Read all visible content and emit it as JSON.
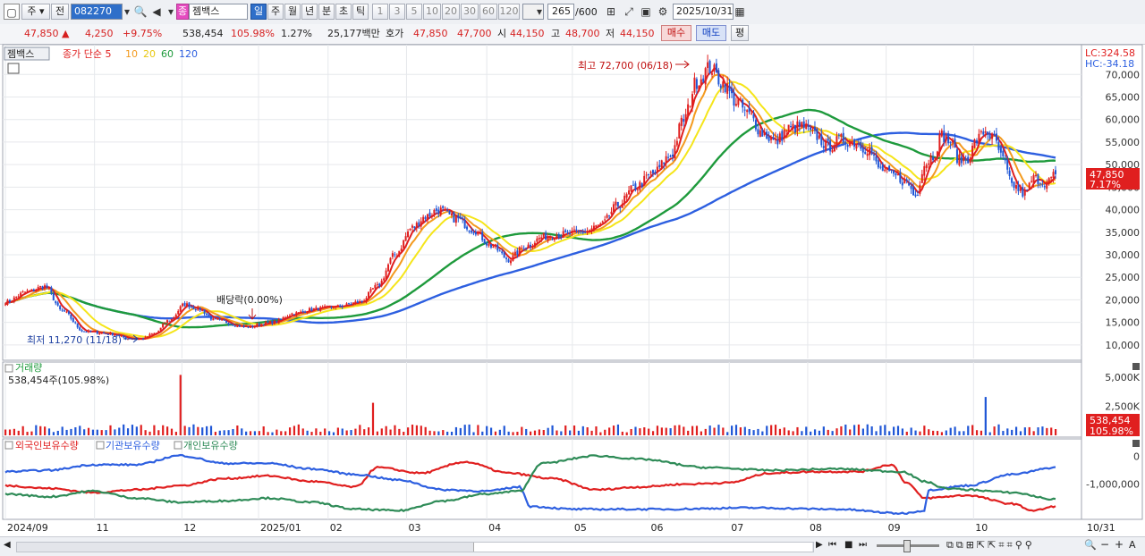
{
  "toolbar": {
    "market": "주",
    "prev_label": "전",
    "stock_code": "082270",
    "stock_name": "젬백스",
    "period_labels": [
      "일",
      "주",
      "월",
      "년",
      "분",
      "초",
      "틱"
    ],
    "interval_labels": [
      "1",
      "3",
      "5",
      "10",
      "20",
      "30",
      "60",
      "120"
    ],
    "count": "265",
    "count_total": "/600",
    "date": "2025/10/31"
  },
  "info": {
    "price": "47,850",
    "change": "4,250",
    "change_pct": "+9.75%",
    "volume": "538,454",
    "volume_ratio": "105.98%",
    "turnover": "1.27%",
    "amount": "25,177백만",
    "quote_label": "호가",
    "ask": "47,850",
    "bid": "47,700",
    "open_label": "시",
    "open": "44,150",
    "high_label": "고",
    "high": "48,700",
    "low_label": "저",
    "low": "44,150",
    "buy_label": "매수",
    "sell_label": "매도",
    "eval_label": "평"
  },
  "colors": {
    "up": "#e01f1f",
    "down": "#1f56d6",
    "ma5": "#e01f1f",
    "ma10": "#f39a1e",
    "ma20": "#f5e51a",
    "ma60": "#1e9a3c",
    "ma120": "#2d5fe0",
    "foreign": "#e01f1f",
    "institution": "#2d5fe0",
    "individual": "#2e8b57"
  },
  "chart_data": [
    {
      "type": "candlestick",
      "title": "젬백스",
      "legend": [
        "종가 단순 5",
        "10",
        "20",
        "60",
        "120"
      ],
      "scale_top": "LC:324.58",
      "scale_bottom": "HC:-34.18",
      "y_ticks": [
        "70,000",
        "65,000",
        "60,000",
        "55,000",
        "50,000",
        "45,000",
        "40,000",
        "35,000",
        "30,000",
        "25,000",
        "20,000",
        "15,000",
        "10,000"
      ],
      "ylim": [
        7000,
        76000
      ],
      "x_ticks": [
        "2024/09",
        "11",
        "12",
        "2025/01",
        "02",
        "03",
        "04",
        "05",
        "06",
        "07",
        "08",
        "09",
        "10",
        "10/31"
      ],
      "annotations": {
        "high": "최고 72,700 (06/18)",
        "low": "최저 11,270 (11/18)",
        "dividend": "배당락(0.00%)"
      },
      "last_price_label": "47,850",
      "last_change_label": "7.17%",
      "close_anchors": [
        [
          0,
          19500
        ],
        [
          10,
          21800
        ],
        [
          18,
          23000
        ],
        [
          26,
          17500
        ],
        [
          36,
          13000
        ],
        [
          48,
          12500
        ],
        [
          56,
          11500
        ],
        [
          62,
          11300
        ],
        [
          68,
          12500
        ],
        [
          75,
          15500
        ],
        [
          82,
          19000
        ],
        [
          88,
          18000
        ],
        [
          96,
          15500
        ],
        [
          110,
          14000
        ],
        [
          122,
          15000
        ],
        [
          132,
          17000
        ],
        [
          142,
          18000
        ],
        [
          152,
          18500
        ],
        [
          162,
          19500
        ],
        [
          170,
          23000
        ],
        [
          178,
          30000
        ],
        [
          186,
          36000
        ],
        [
          192,
          38500
        ],
        [
          198,
          40000
        ],
        [
          206,
          38000
        ],
        [
          214,
          35500
        ],
        [
          222,
          32000
        ],
        [
          230,
          29000
        ],
        [
          238,
          32000
        ],
        [
          246,
          34000
        ],
        [
          254,
          34500
        ],
        [
          264,
          35000
        ],
        [
          272,
          36500
        ],
        [
          280,
          41000
        ],
        [
          288,
          45000
        ],
        [
          296,
          48000
        ],
        [
          304,
          52000
        ],
        [
          310,
          60000
        ],
        [
          316,
          68500
        ],
        [
          322,
          71500
        ],
        [
          328,
          68000
        ],
        [
          334,
          64000
        ],
        [
          340,
          61000
        ],
        [
          346,
          57000
        ],
        [
          352,
          55000
        ],
        [
          358,
          58000
        ],
        [
          364,
          58500
        ],
        [
          370,
          56500
        ],
        [
          376,
          54000
        ],
        [
          382,
          55500
        ],
        [
          388,
          55000
        ],
        [
          394,
          53500
        ],
        [
          400,
          49000
        ],
        [
          406,
          47500
        ],
        [
          412,
          46000
        ],
        [
          416,
          43000
        ],
        [
          420,
          50000
        ],
        [
          424,
          52000
        ],
        [
          428,
          56500
        ],
        [
          432,
          55000
        ],
        [
          436,
          51000
        ],
        [
          440,
          51500
        ],
        [
          444,
          55500
        ],
        [
          448,
          57500
        ],
        [
          452,
          55500
        ],
        [
          456,
          51000
        ],
        [
          460,
          45500
        ],
        [
          466,
          43500
        ],
        [
          470,
          47000
        ],
        [
          476,
          46000
        ],
        [
          480,
          47850
        ]
      ]
    },
    {
      "type": "bar",
      "title": "거래량",
      "value_label": "538,454주(105.98%)",
      "y_ticks": [
        "5,000K",
        "2,500K"
      ],
      "ylim": [
        0,
        6000000
      ],
      "last_label": "538,454",
      "last_ratio_label": "105.98%"
    },
    {
      "type": "line",
      "legend": [
        "외국인보유수량",
        "기관보유수량",
        "개인보유수량"
      ],
      "y_ticks": [
        "0",
        "-1,000,000"
      ],
      "ylim": [
        -2200000,
        500000
      ],
      "series": [
        {
          "name": "외국인보유수량",
          "anchors": [
            [
              0,
              -1050000
            ],
            [
              20,
              -1150000
            ],
            [
              40,
              -1300000
            ],
            [
              60,
              -1200000
            ],
            [
              80,
              -1050000
            ],
            [
              100,
              -800000
            ],
            [
              120,
              -700000
            ],
            [
              140,
              -900000
            ],
            [
              160,
              -1100000
            ],
            [
              170,
              -400000
            ],
            [
              190,
              -600000
            ],
            [
              210,
              -200000
            ],
            [
              230,
              -600000
            ],
            [
              250,
              -800000
            ],
            [
              270,
              -1200000
            ],
            [
              290,
              -1100000
            ],
            [
              310,
              -1000000
            ],
            [
              330,
              -950000
            ],
            [
              350,
              -600000
            ],
            [
              370,
              -550000
            ],
            [
              390,
              -550000
            ],
            [
              405,
              -300000
            ],
            [
              412,
              -950000
            ],
            [
              420,
              -1500000
            ],
            [
              440,
              -1400000
            ],
            [
              460,
              -1700000
            ],
            [
              470,
              -1950000
            ],
            [
              480,
              -1800000
            ]
          ]
        },
        {
          "name": "기관보유수량",
          "anchors": [
            [
              0,
              -550000
            ],
            [
              20,
              -500000
            ],
            [
              40,
              -300000
            ],
            [
              60,
              -300000
            ],
            [
              80,
              30000
            ],
            [
              100,
              -250000
            ],
            [
              120,
              -250000
            ],
            [
              140,
              -450000
            ],
            [
              160,
              -650000
            ],
            [
              180,
              -850000
            ],
            [
              200,
              -1200000
            ],
            [
              220,
              -1250000
            ],
            [
              235,
              -1100000
            ],
            [
              240,
              -1800000
            ],
            [
              260,
              -1900000
            ],
            [
              300,
              -1900000
            ],
            [
              340,
              -1850000
            ],
            [
              380,
              -1900000
            ],
            [
              410,
              -2050000
            ],
            [
              420,
              -1950000
            ],
            [
              422,
              -1200000
            ],
            [
              440,
              -1050000
            ],
            [
              460,
              -650000
            ],
            [
              480,
              -400000
            ]
          ]
        },
        {
          "name": "개인보유수량",
          "anchors": [
            [
              0,
              -1350000
            ],
            [
              20,
              -1450000
            ],
            [
              40,
              -1250000
            ],
            [
              60,
              -1500000
            ],
            [
              80,
              -1650000
            ],
            [
              100,
              -1600000
            ],
            [
              120,
              -1500000
            ],
            [
              140,
              -1650000
            ],
            [
              160,
              -1900000
            ],
            [
              180,
              -1950000
            ],
            [
              200,
              -1600000
            ],
            [
              220,
              -1350000
            ],
            [
              235,
              -1250000
            ],
            [
              245,
              -250000
            ],
            [
              270,
              20000
            ],
            [
              290,
              -100000
            ],
            [
              320,
              -400000
            ],
            [
              350,
              -500000
            ],
            [
              380,
              -450000
            ],
            [
              410,
              -550000
            ],
            [
              420,
              -900000
            ],
            [
              430,
              -1150000
            ],
            [
              440,
              -1200000
            ],
            [
              460,
              -1300000
            ],
            [
              480,
              -1550000
            ]
          ]
        }
      ]
    }
  ],
  "bottom": {
    "scroll_icons": [
      "prev",
      "stop",
      "next"
    ]
  }
}
